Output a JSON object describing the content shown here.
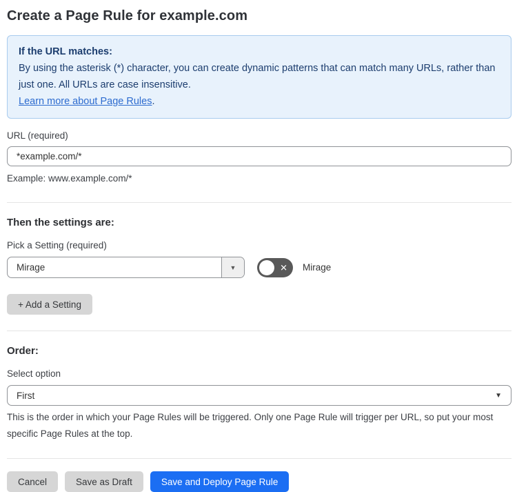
{
  "page": {
    "title": "Create a Page Rule for example.com"
  },
  "info_box": {
    "heading": "If the URL matches:",
    "body": "By using the asterisk (*) character, you can create dynamic patterns that can match many URLs, rather than just one. All URLs are case insensitive.",
    "link_label": "Learn more about Page Rules",
    "link_suffix": "."
  },
  "url_field": {
    "label": "URL (required)",
    "value": "*example.com/*",
    "example": "Example: www.example.com/*"
  },
  "settings_section": {
    "heading": "Then the settings are:",
    "setting_label": "Pick a Setting (required)",
    "setting_value": "Mirage",
    "dropdown_arrow": "▼",
    "toggle_state": "off",
    "toggle_glyph": "✕",
    "toggle_label": "Mirage",
    "add_button_label": "+ Add a Setting"
  },
  "order_section": {
    "heading": "Order:",
    "select_label": "Select option",
    "select_value": "First",
    "select_arrow": "▼",
    "helper": "This is the order in which your Page Rules will be triggered. Only one Page Rule will trigger per URL, so put your most specific Page Rules at the top."
  },
  "footer": {
    "cancel_label": "Cancel",
    "draft_label": "Save as Draft",
    "deploy_label": "Save and Deploy Page Rule"
  },
  "colors": {
    "accent_blue": "#1b6ef3",
    "info_background": "#e8f2fc",
    "info_border": "#a8cbee",
    "info_text": "#1c3d6e",
    "link_blue": "#2c6bcf",
    "toggle_off_gray": "#595959",
    "button_gray": "#d6d6d6"
  }
}
